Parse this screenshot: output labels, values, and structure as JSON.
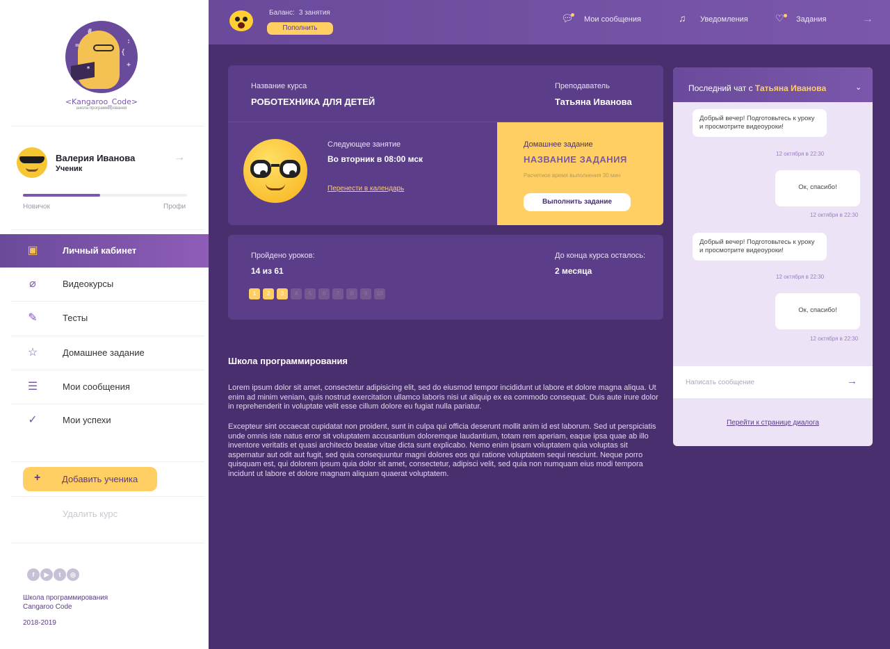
{
  "logo": {
    "text": "<Kangaroo_Code>",
    "subtitle": "школа программирования",
    "symbols": [
      "#",
      ":",
      "=",
      "{",
      "+",
      "*"
    ]
  },
  "user": {
    "name": "Валерия Иванова",
    "role": "Ученик",
    "level_left": "Новичок",
    "level_right": "Профи",
    "progress": 0.47
  },
  "nav": {
    "items": [
      {
        "label": "Личный кабинет",
        "icon": "profile-card-icon",
        "active": true
      },
      {
        "label": "Видеокурсы",
        "icon": "paperclip-icon",
        "active": false
      },
      {
        "label": "Тесты",
        "icon": "test-sheet-icon",
        "active": false
      },
      {
        "label": "Домашнее задание",
        "icon": "star-icon",
        "active": false
      },
      {
        "label": "Мои сообщения",
        "icon": "message-icon",
        "active": false
      },
      {
        "label": "Мои успехи",
        "icon": "success-icon",
        "active": false
      }
    ],
    "add_student": "Добавить ученика",
    "delete_course": "Удалить курс"
  },
  "footer": {
    "socials": [
      "facebook-icon",
      "youtube-icon",
      "twitter-icon",
      "instagram-icon"
    ],
    "school_line1": "Школа программирования",
    "school_line2": "Cangaroo Code",
    "years": "2018-2019"
  },
  "topbar": {
    "balance_label": "Баланс:",
    "balance_value": "3 занятия",
    "topup": "Пополнить",
    "messages": "Мои сообщения",
    "notifications": "Уведомления",
    "tasks": "Задания"
  },
  "course": {
    "name_label": "Название курса",
    "name": "РОБОТЕХНИКА ДЛЯ ДЕТЕЙ",
    "teacher_label": "Преподаватель",
    "teacher": "Татьяна Иванова",
    "next_label": "Следующее занятие",
    "next_value": "Во вторник в 08:00 мск",
    "calendar_link": "Перенести в календарь"
  },
  "homework": {
    "label": "Домашнее задание",
    "title": "НАЗВАНИЕ ЗАДАНИЯ",
    "time": "Расчетное время выполнения 30 мин",
    "button": "Выполнить задание"
  },
  "progress_card": {
    "passed_label": "Пройдено уроков:",
    "passed_value": "14 из 61",
    "remaining_label": "До конца курса осталось:",
    "remaining_value": "2 месяца",
    "lessons": [
      "1",
      "2",
      "3",
      "4",
      "5",
      "6",
      "7",
      "8",
      "9",
      "10"
    ],
    "done_count": 3
  },
  "school": {
    "title": "Школа программирования",
    "p1": "Lorem ipsum dolor sit amet, consectetur adipisicing elit, sed do eiusmod tempor incididunt ut labore et dolore magna aliqua. Ut enim ad minim veniam, quis nostrud exercitation ullamco laboris nisi ut aliquip ex ea commodo consequat. Duis aute irure dolor in reprehenderit in voluptate velit esse cillum dolore eu fugiat nulla pariatur.",
    "p2": "Excepteur sint occaecat cupidatat non proident, sunt in culpa qui officia deserunt mollit anim id est laborum. Sed ut perspiciatis unde omnis iste natus error sit voluptatem accusantium doloremque laudantium, totam rem aperiam, eaque ipsa quae ab illo inventore veritatis et quasi architecto beatae vitae dicta sunt explicabo. Nemo enim ipsam voluptatem quia voluptas sit aspernatur aut odit aut fugit, sed quia consequuntur magni dolores eos qui ratione voluptatem sequi nesciunt. Neque porro quisquam est, qui dolorem ipsum quia dolor sit amet, consectetur, adipisci velit, sed quia non numquam eius modi tempora incidunt ut labore et dolore magnam aliquam quaerat voluptatem."
  },
  "chat": {
    "head_prefix": "Последний чат с",
    "head_name": "Татьяна Иванова",
    "messages": [
      {
        "text": "Добрый вечер! Подготовьтесь к уроку и просмотрите видеоуроки!",
        "time": "12 октября в 22:30"
      },
      {
        "text": "Ок, спасибо!",
        "time": "12 октября в 22:30"
      },
      {
        "text": "Добрый вечер! Подготовьтесь к уроку и просмотрите видеоуроки!",
        "time": "12 октября в 22:30"
      },
      {
        "text": "Ок, спасибо!",
        "time": "12 октября в 22:30"
      }
    ],
    "input_placeholder": "Написать сообщение",
    "dialog_link": "Перейти к странице диалога"
  }
}
